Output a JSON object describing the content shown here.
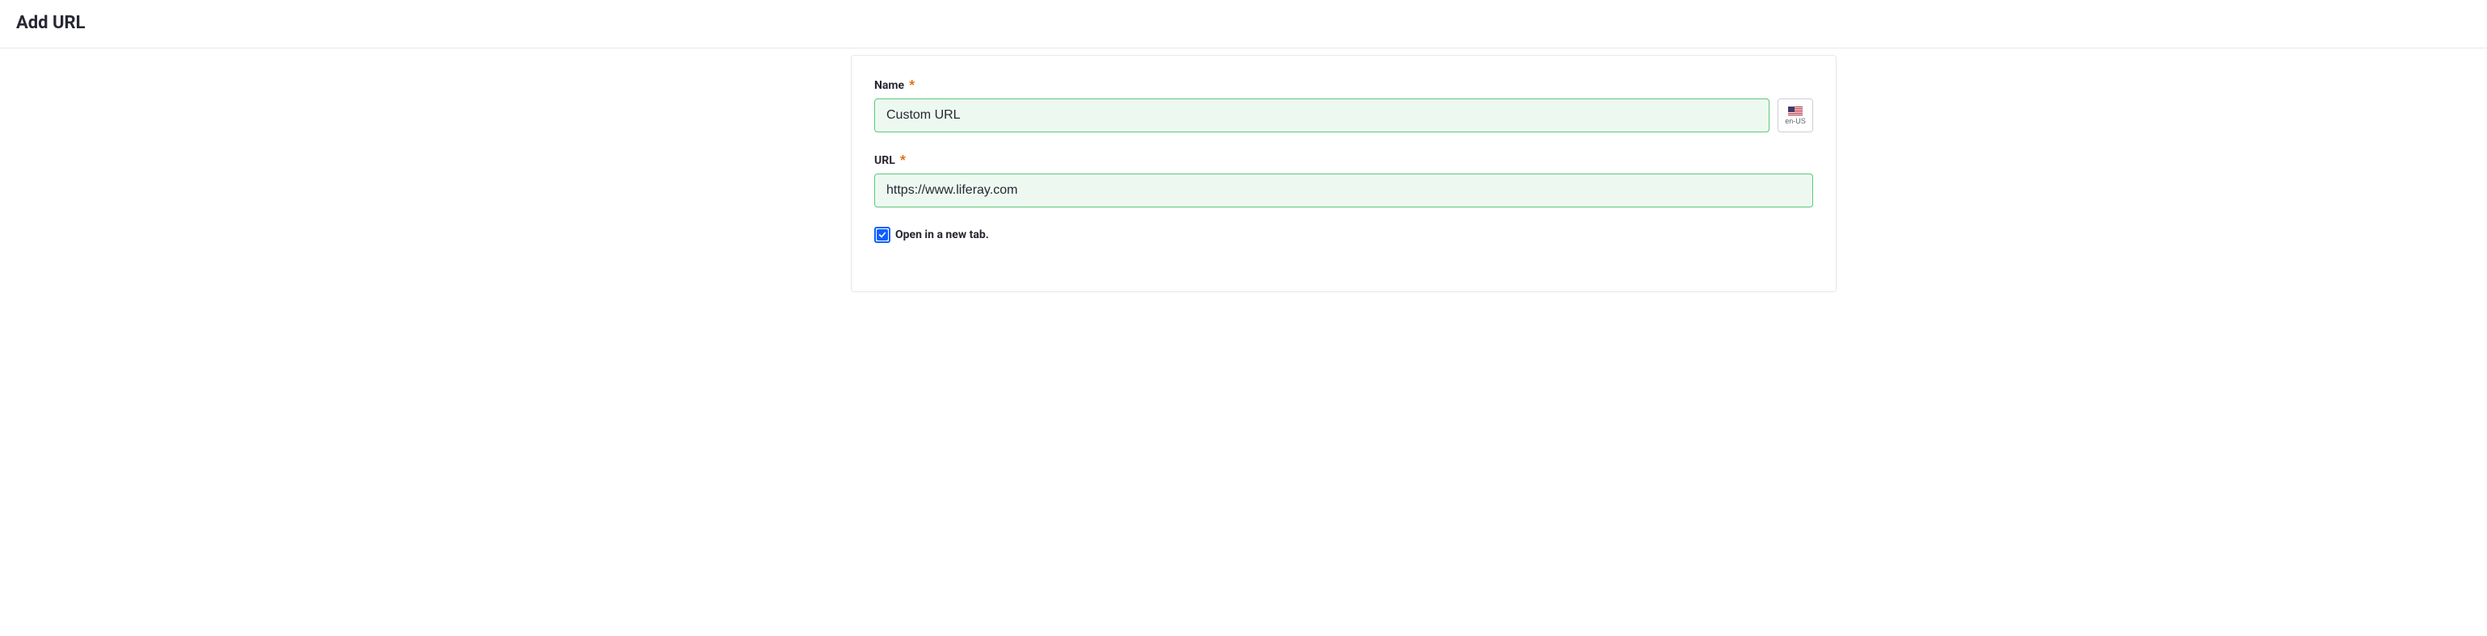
{
  "header": {
    "title": "Add URL"
  },
  "form": {
    "name": {
      "label": "Name",
      "required_marker": "*",
      "value": "Custom URL"
    },
    "locale": {
      "code": "en-US"
    },
    "url": {
      "label": "URL",
      "required_marker": "*",
      "value": "https://www.liferay.com"
    },
    "open_new_tab": {
      "label": "Open in a new tab.",
      "checked": true
    }
  }
}
